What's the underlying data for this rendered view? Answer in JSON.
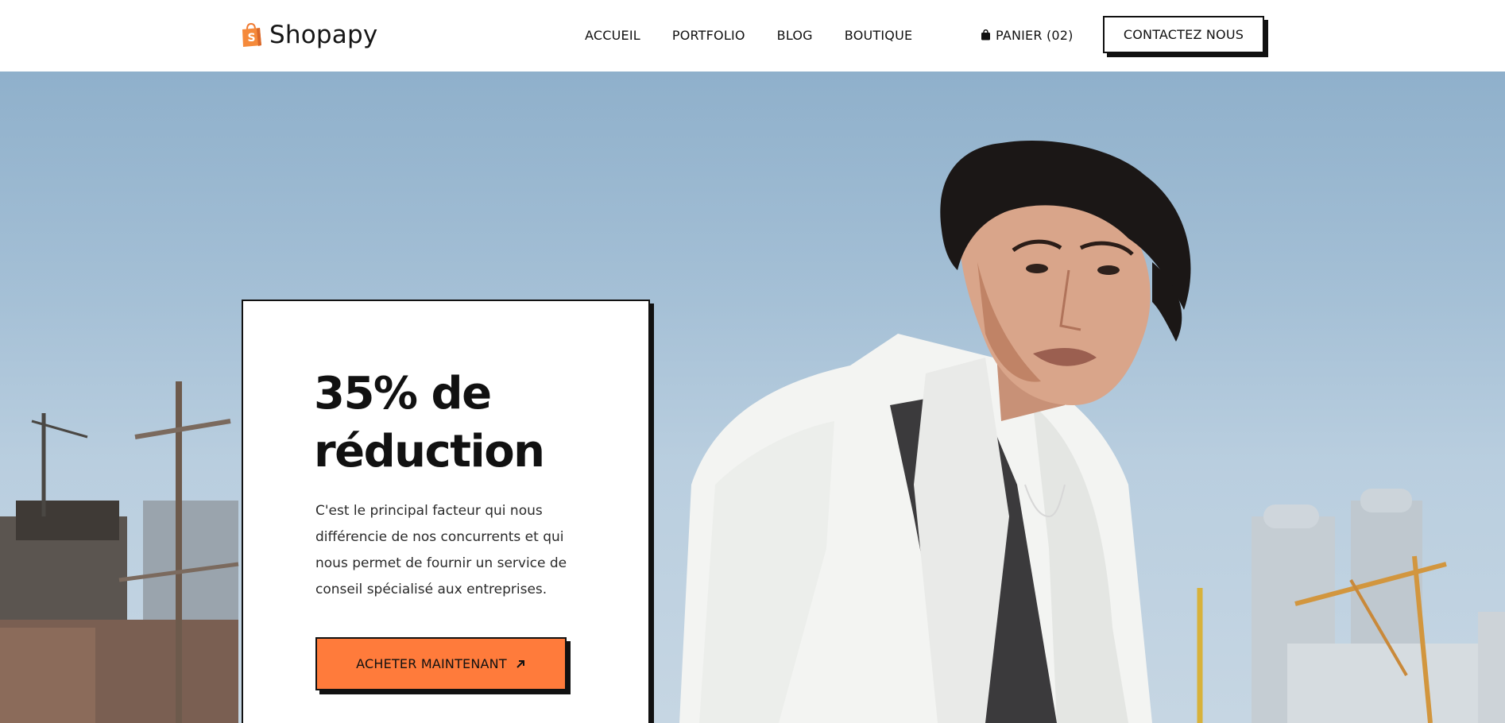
{
  "brand": {
    "name": "Shopapy",
    "accent_color": "#ff7b3b",
    "logo_icon": "shopping-bag-icon"
  },
  "nav": {
    "items": [
      {
        "label": "ACCUEIL"
      },
      {
        "label": "PORTFOLIO"
      },
      {
        "label": "BLOG"
      },
      {
        "label": "BOUTIQUE"
      }
    ]
  },
  "cart": {
    "label": "PANIER (02)",
    "icon": "shopping-bag-icon"
  },
  "contact_button": {
    "label": "CONTACTEZ NOUS"
  },
  "promo": {
    "title_line1": "35% de",
    "title_line2": "réduction",
    "text": "C'est le principal facteur qui nous différencie de nos concurrents et qui nous permet de fournir un service de conseil spécialisé aux entreprises.",
    "button_label": "ACHETER MAINTENANT",
    "button_icon": "arrow-up-right-icon"
  }
}
